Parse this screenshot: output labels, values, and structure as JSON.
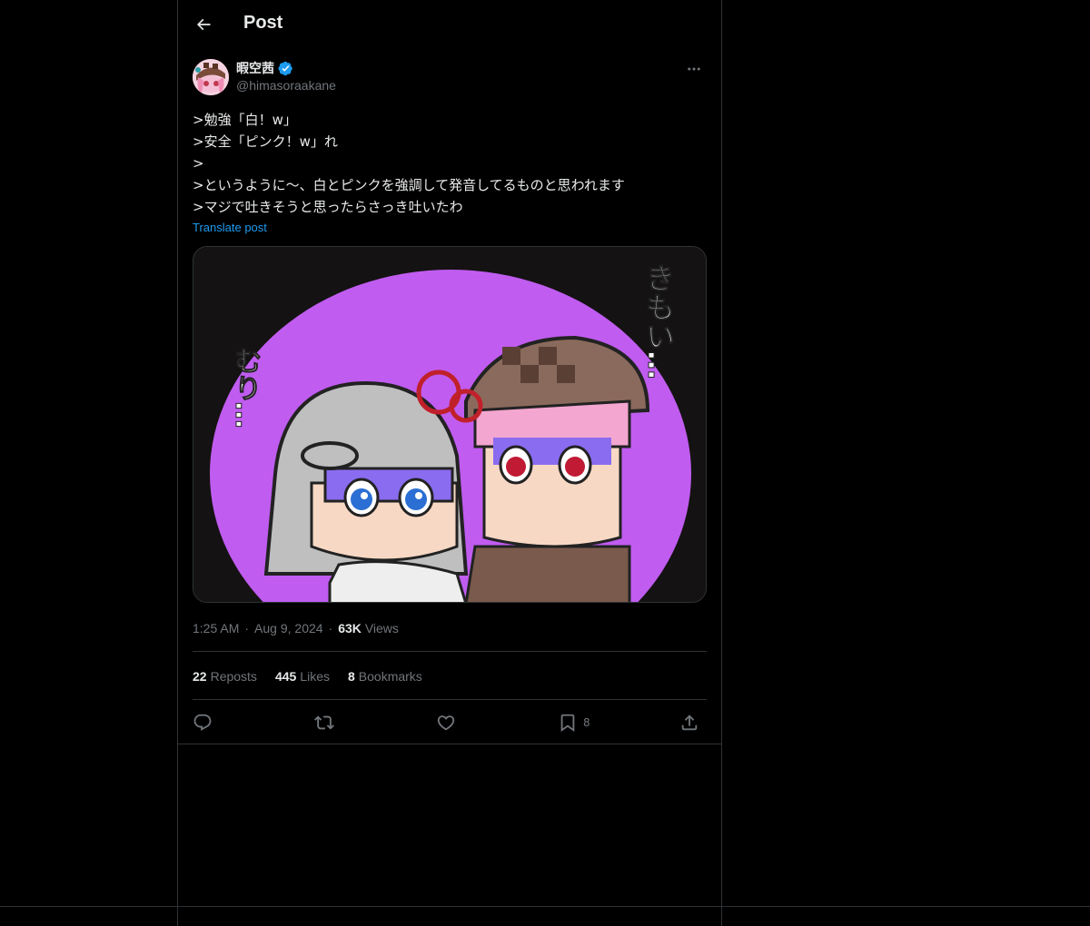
{
  "header": {
    "title": "Post"
  },
  "author": {
    "display_name": "暇空茜",
    "handle": "@himasoraakane"
  },
  "post": {
    "lines": [
      ">勉強「白！w」",
      ">安全「ピンク！w」れ",
      ">",
      ">というように〜、白とピンクを強調して発音してるものと思われます",
      ">マジで吐きそうと思ったらさっき吐いたわ"
    ],
    "translate_label": "Translate post"
  },
  "media": {
    "left_text": "むり…",
    "right_text": "きもい…"
  },
  "meta": {
    "time": "1:25 AM",
    "date": "Aug 9, 2024",
    "views_count": "63K",
    "views_label": "Views",
    "separator": "·"
  },
  "stats": {
    "reposts_count": "22",
    "reposts_label": "Reposts",
    "likes_count": "445",
    "likes_label": "Likes",
    "bookmarks_count": "8",
    "bookmarks_label": "Bookmarks"
  },
  "actions": {
    "bookmark_count": "8"
  },
  "colors": {
    "background": "#000000",
    "border": "#2f3336",
    "text": "#e7e9ea",
    "muted": "#71767b",
    "link": "#1d9bf0",
    "verified": "#1d9bf0",
    "image_purple": "#c05cf0"
  },
  "icons": [
    "back-arrow-icon",
    "verified-badge-icon",
    "more-icon",
    "reply-icon",
    "repost-icon",
    "like-icon",
    "bookmark-icon",
    "share-icon"
  ]
}
